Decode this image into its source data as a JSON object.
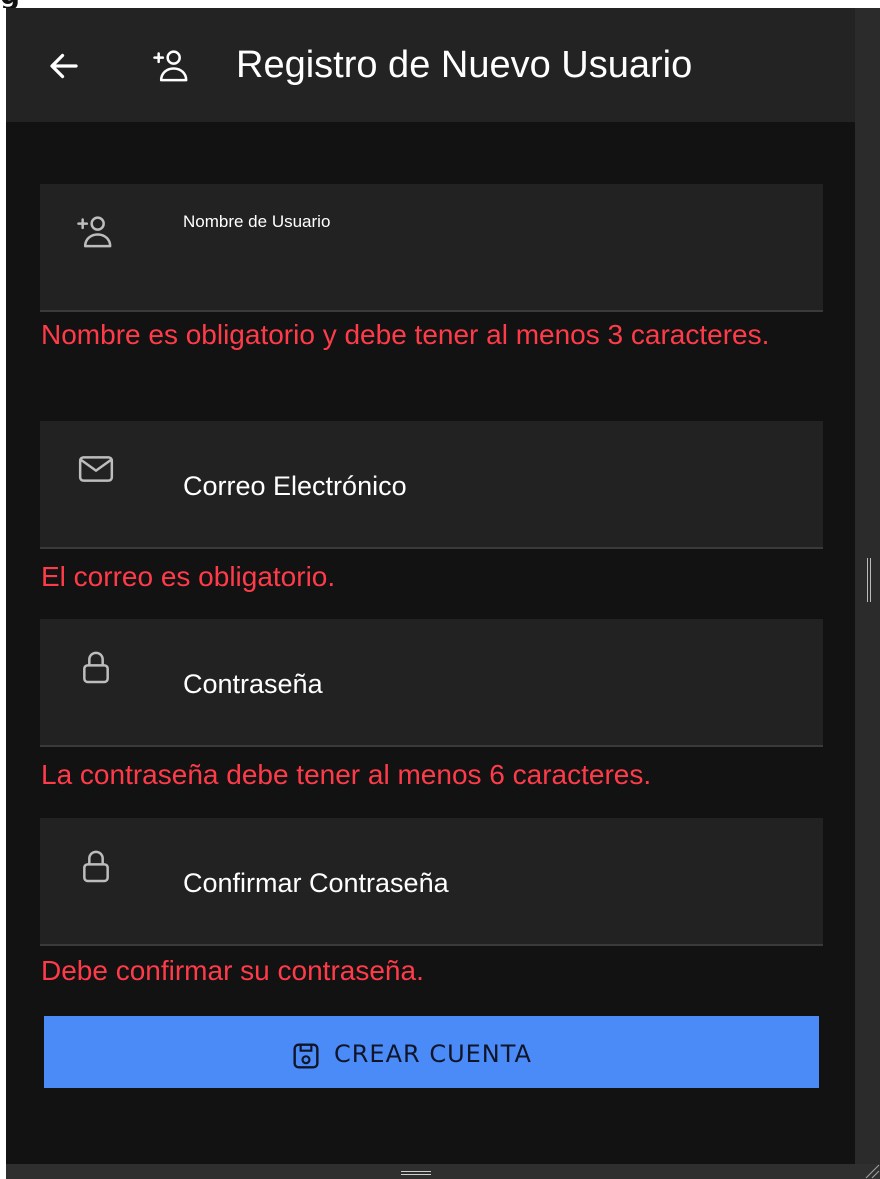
{
  "header": {
    "title": "Registro de Nuevo Usuario",
    "back_icon": "arrow-left-icon",
    "title_icon": "person-add-icon"
  },
  "form": {
    "fields": [
      {
        "label": "Nombre de Usuario",
        "icon": "person-add-icon",
        "error": "Nombre es obligatorio y debe tener al menos 3 caracteres."
      },
      {
        "label": "Correo Electrónico",
        "icon": "mail-icon",
        "error": "El correo es obligatorio."
      },
      {
        "label": "Contraseña",
        "icon": "lock-icon",
        "error": "La contraseña debe tener al menos 6 caracteres."
      },
      {
        "label": "Confirmar Contraseña",
        "icon": "lock-icon",
        "error": "Debe confirmar su contraseña."
      }
    ],
    "submit": {
      "label": "CREAR CUENTA",
      "icon": "save-icon"
    }
  },
  "colors": {
    "background": "#121212",
    "appbar": "#232323",
    "field": "#222222",
    "error": "#ff3b49",
    "primary": "#4a8bf7"
  }
}
